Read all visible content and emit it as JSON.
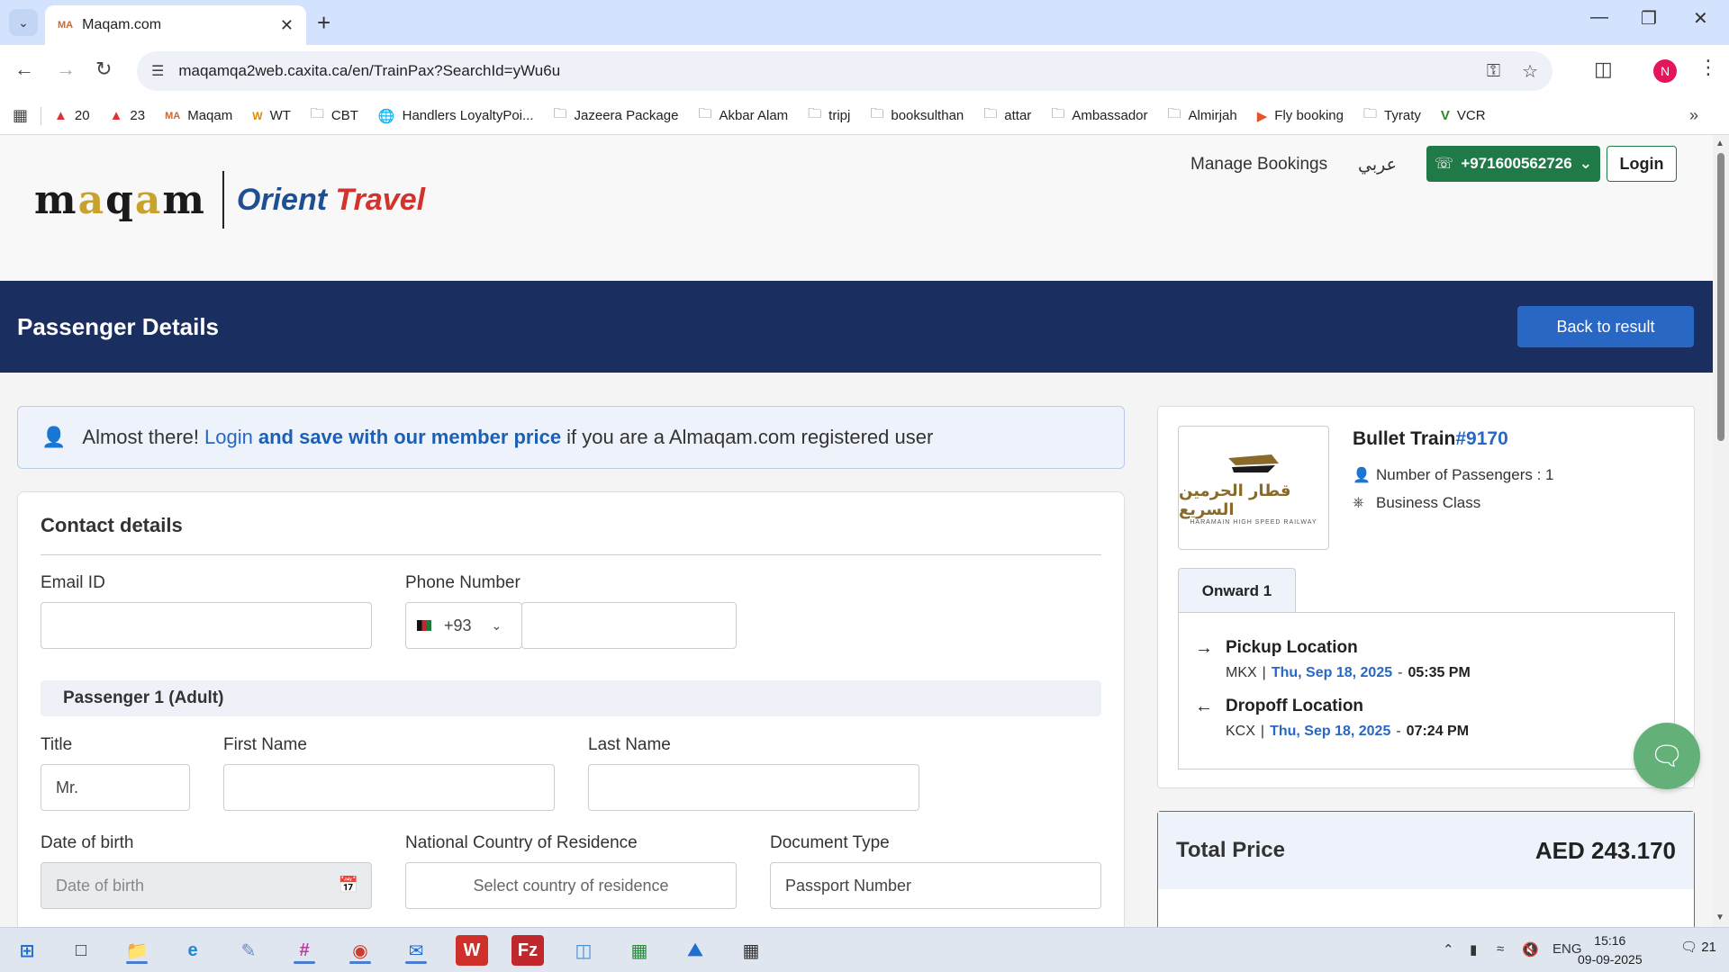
{
  "browser": {
    "tab_title": "Maqam.com",
    "url": "maqamqa2web.caxita.ca/en/TrainPax?SearchId=yWu6u",
    "profile_initial": "N",
    "bookmarks": [
      {
        "label": "20",
        "icon": "redhat-icon"
      },
      {
        "label": "23",
        "icon": "redhat-icon"
      },
      {
        "label": "Maqam",
        "icon": "maqam-icon"
      },
      {
        "label": "WT",
        "icon": "wt-icon"
      },
      {
        "label": "CBT",
        "icon": "folder-icon"
      },
      {
        "label": "Handlers LoyaltyPoi...",
        "icon": "globe-icon"
      },
      {
        "label": "Jazeera Package",
        "icon": "folder-icon"
      },
      {
        "label": "Akbar Alam",
        "icon": "folder-icon"
      },
      {
        "label": "tripj",
        "icon": "folder-icon"
      },
      {
        "label": "booksulthan",
        "icon": "folder-icon"
      },
      {
        "label": "attar",
        "icon": "folder-icon"
      },
      {
        "label": "Ambassador",
        "icon": "folder-icon"
      },
      {
        "label": "Almirjah",
        "icon": "folder-icon"
      },
      {
        "label": "Fly booking",
        "icon": "flybooking-icon"
      },
      {
        "label": "Tyraty",
        "icon": "folder-icon"
      },
      {
        "label": "VCR",
        "icon": "vcr-icon"
      }
    ]
  },
  "header": {
    "manage_bookings": "Manage Bookings",
    "arabic": "عربي",
    "phone": "+971600562726",
    "login": "Login"
  },
  "banner": {
    "title": "Passenger Details",
    "back_button": "Back to result"
  },
  "alert": {
    "prefix": "Almost there!",
    "login_link": "Login",
    "save_link": "and save with our member price",
    "suffix": "if you are a Almaqam.com registered user"
  },
  "contact": {
    "title": "Contact details",
    "email_label": "Email ID",
    "email_value": "",
    "phone_label": "Phone Number",
    "dial_code": "+93",
    "phone_value": ""
  },
  "passenger": {
    "heading": "Passenger 1 (Adult)",
    "title_label": "Title",
    "title_value": "Mr.",
    "first_name_label": "First Name",
    "last_name_label": "Last Name",
    "dob_label": "Date of birth",
    "dob_placeholder": "Date of birth",
    "country_label": "National Country of Residence",
    "country_placeholder": "Select country of residence",
    "doc_type_label": "Document Type",
    "doc_type_value": "Passport Number"
  },
  "summary": {
    "train_prefix": "Bullet Train",
    "train_number": "#9170",
    "passengers": "Number of Passengers : 1",
    "class": "Business Class",
    "logo_ar": "قطار الحرمين السريع",
    "logo_en": "HARAMAIN HIGH SPEED RAILWAY",
    "tab": "Onward 1",
    "pickup": {
      "title": "Pickup Location",
      "code": "MKX",
      "date": "Thu, Sep 18, 2025",
      "time": "05:35 PM"
    },
    "dropoff": {
      "title": "Dropoff Location",
      "code": "KCX",
      "date": "Thu, Sep 18, 2025",
      "time": "07:24 PM"
    }
  },
  "price": {
    "label": "Total Price",
    "value": "AED 243.170"
  },
  "taskbar": {
    "language": "ENG",
    "time": "15:16",
    "date": "09-09-2025",
    "notifications": "21"
  }
}
